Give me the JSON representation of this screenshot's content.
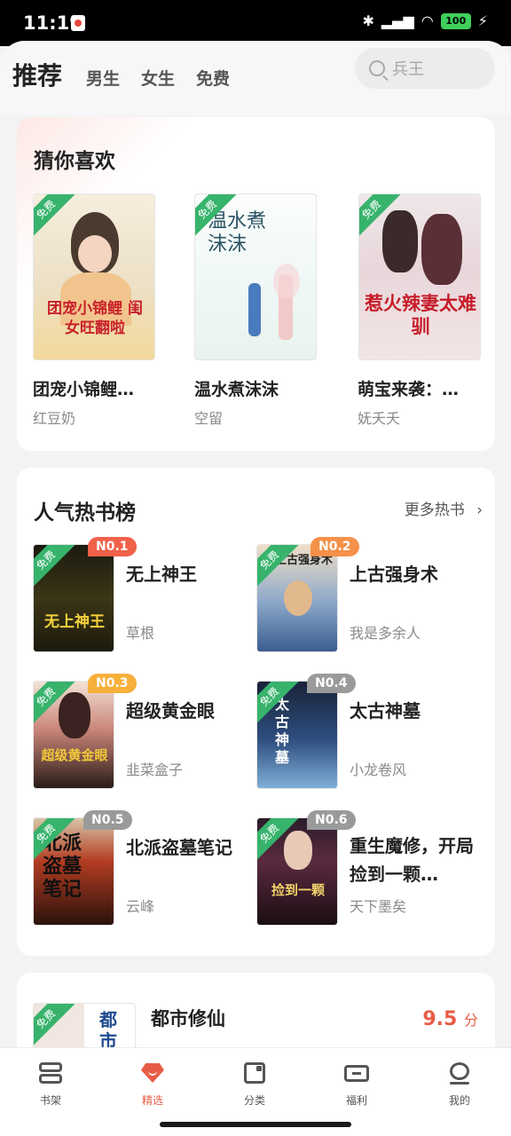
{
  "status": {
    "time": "11:19",
    "battery": "100"
  },
  "topnav": {
    "tabs": [
      "推荐",
      "男生",
      "女生",
      "免费"
    ],
    "search_placeholder": "兵王"
  },
  "free_label": "免费",
  "guess": {
    "title": "猜你喜欢",
    "books": [
      {
        "name": "团宠小锦鲤…",
        "author": "红豆奶",
        "cover_text": "团宠小锦鲤 闺女旺翻啦"
      },
      {
        "name": "温水煮沫沫",
        "author": "空留",
        "cover_text": "温水煮沫沫"
      },
      {
        "name": "萌宝来袭：…",
        "author": "妩夭夭",
        "cover_text": "惹火辣妻太难驯"
      }
    ]
  },
  "hot": {
    "title": "人气热书榜",
    "more": "更多热书",
    "books": [
      {
        "rank": "N0.1",
        "name": "无上神王",
        "author": "草根",
        "cover_text": "无上神王"
      },
      {
        "rank": "N0.2",
        "name": "上古强身术",
        "author": "我是多余人",
        "cover_text": "上古强身术"
      },
      {
        "rank": "N0.3",
        "name": "超级黄金眼",
        "author": "韭菜盒子",
        "cover_text": "超级黄金眼"
      },
      {
        "rank": "N0.4",
        "name": "太古神墓",
        "author": "小龙卷风",
        "cover_text": "太古神墓"
      },
      {
        "rank": "N0.5",
        "name": "北派盗墓笔记",
        "author": "云峰",
        "cover_text": "北派盗墓笔记"
      },
      {
        "rank": "N0.6",
        "name": "重生魔修，开局捡到一颗…",
        "author": "天下墨矣",
        "cover_text": "捡到一颗"
      }
    ]
  },
  "next": {
    "name": "都市修仙",
    "rating": "9.5",
    "rating_unit": "分",
    "cover_text": "都市"
  },
  "bottom_nav": [
    "书架",
    "精选",
    "分类",
    "福利",
    "我的"
  ],
  "colors": {
    "accent": "#e85c47",
    "free_green": "#37b36c",
    "rank1": "#f0614a",
    "rank2": "#f5914a",
    "rank3": "#f7b03a",
    "rank_other": "#9a9a9a"
  }
}
